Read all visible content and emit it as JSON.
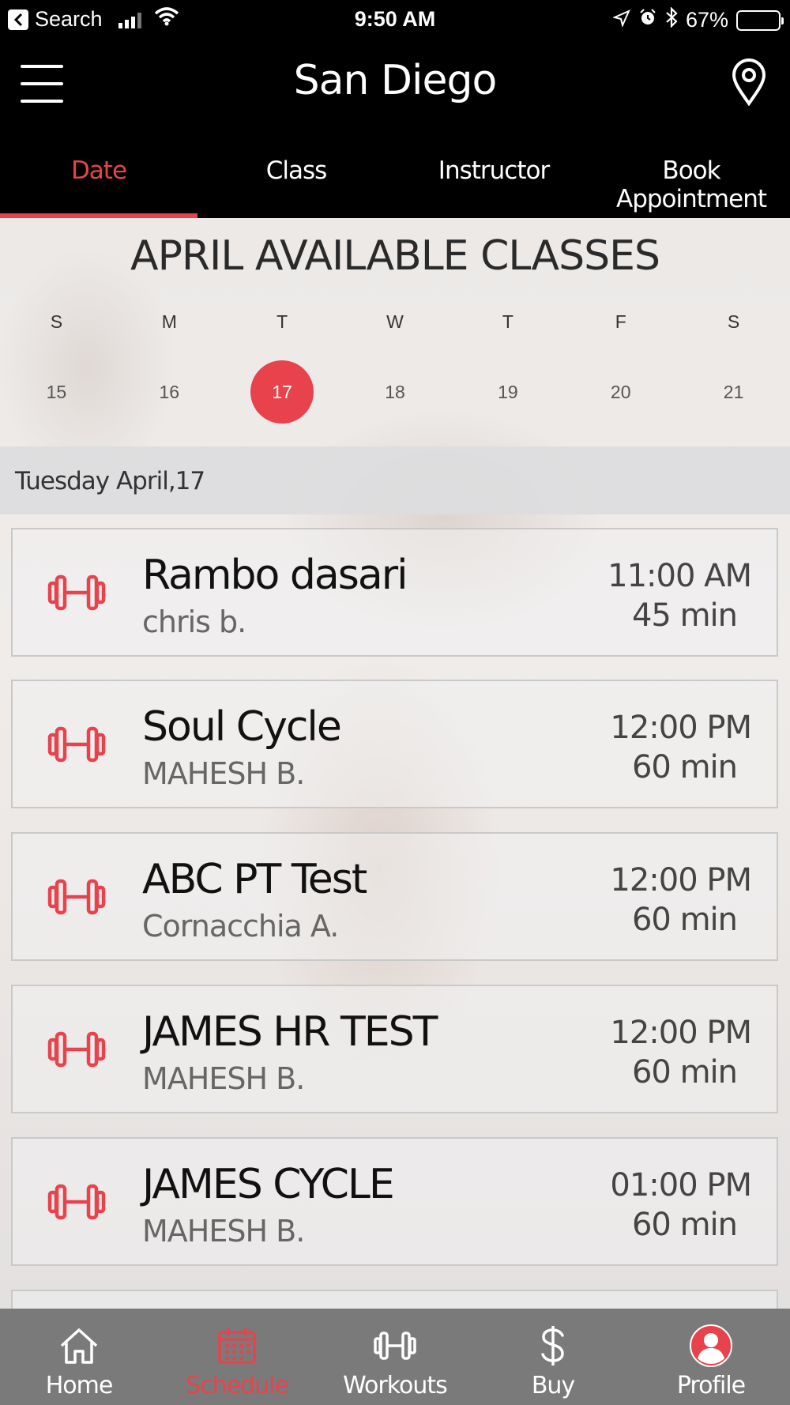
{
  "status_bar": {
    "back_label": "Search",
    "time": "9:50 AM",
    "battery": "67%",
    "battery_level": 0.67
  },
  "header": {
    "title": "San Diego"
  },
  "tabs": [
    {
      "label": "Date",
      "active": true
    },
    {
      "label": "Class",
      "active": false
    },
    {
      "label": "Instructor",
      "active": false
    },
    {
      "label": "Book Appointment",
      "active": false
    }
  ],
  "calendar": {
    "title": "APRIL AVAILABLE CLASSES",
    "weekdays": [
      "S",
      "M",
      "T",
      "W",
      "T",
      "F",
      "S"
    ],
    "dates": [
      "15",
      "16",
      "17",
      "18",
      "19",
      "20",
      "21"
    ],
    "selected": "17"
  },
  "day_header": "Tuesday April,17",
  "classes": [
    {
      "name": "Rambo dasari",
      "instructor": "chris b.",
      "time": "11:00 AM",
      "duration": "45 min"
    },
    {
      "name": "Soul Cycle",
      "instructor": "MAHESH B.",
      "time": "12:00 PM",
      "duration": "60 min"
    },
    {
      "name": "ABC PT Test",
      "instructor": "Cornacchia A.",
      "time": "12:00 PM",
      "duration": "60 min"
    },
    {
      "name": "JAMES HR TEST",
      "instructor": "MAHESH B.",
      "time": "12:00 PM",
      "duration": "60 min"
    },
    {
      "name": "JAMES CYCLE",
      "instructor": "MAHESH B.",
      "time": "01:00 PM",
      "duration": "60 min"
    }
  ],
  "tabbar": [
    {
      "label": "Home",
      "icon": "home-icon",
      "active": false
    },
    {
      "label": "Schedule",
      "icon": "calendar-icon",
      "active": true
    },
    {
      "label": "Workouts",
      "icon": "dumbbell-icon",
      "active": false
    },
    {
      "label": "Buy",
      "icon": "dollar-icon",
      "active": false
    },
    {
      "label": "Profile",
      "icon": "profile-icon",
      "active": false
    }
  ],
  "colors": {
    "accent": "#e8434d",
    "tabbar_bg": "#7a7a7a",
    "header_bg": "#000000"
  }
}
